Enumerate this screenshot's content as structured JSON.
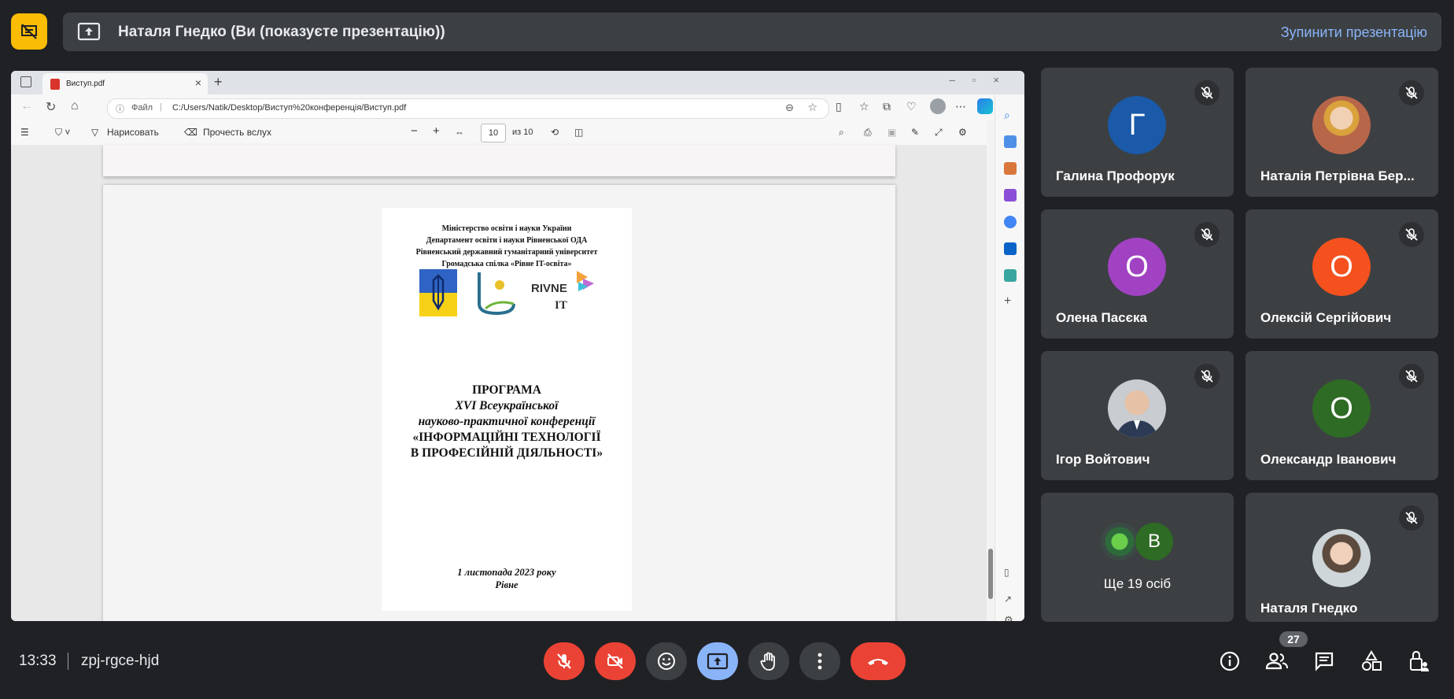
{
  "presentation_bar": {
    "presenter_text": "Наталя Гнедко (Ви (показуєте презентацію))",
    "stop_label": "Зупинити презентацію"
  },
  "browser": {
    "tab_title": "Виступ.pdf",
    "address_scheme": "Файл",
    "address_url": "C:/Users/Natik/Desktop/Виступ%20конференція/Виступ.pdf"
  },
  "pdf_toolbar": {
    "draw_label": "Нарисовать",
    "read_aloud_label": "Прочесть вслух",
    "page_current": "10",
    "page_total": "из 10"
  },
  "document": {
    "header_lines": [
      "Міністерство освіти і науки України",
      "Департамент освіти і науки Рівненської ОДА",
      "Рівненський державний гуманітарний університет",
      "Громадська спілка «Рівне IT-освіта»"
    ],
    "logo_text_1": "RIVNE",
    "logo_text_2": "IT",
    "title_lines": [
      "ПРОГРАМА",
      "XVI Всеукраїнської",
      "науково-практичної конференції",
      "«ІНФОРМАЦІЙНІ ТЕХНОЛОГІЇ",
      "В ПРОФЕСІЙНІЙ ДІЯЛЬНОСТІ»"
    ],
    "date_line": "1 листопада 2023 року",
    "place_line": "Рівне"
  },
  "participants": [
    {
      "name": "Галина Профорук",
      "initial": "Г",
      "color": "#1a5aa8"
    },
    {
      "name": "Наталія Петрівна Бер...",
      "initial": "",
      "color": "#b8664a"
    },
    {
      "name": "Олена Пасєка",
      "initial": "О",
      "color": "#a142c2"
    },
    {
      "name": "Олексій Сергійович",
      "initial": "О",
      "color": "#f4511e"
    },
    {
      "name": "Ігор Войтович",
      "initial": "",
      "color": "#c9ccd0"
    },
    {
      "name": "Олександр Іванович",
      "initial": "О",
      "color": "#2e6b24"
    },
    {
      "name": "Наталя Гнедко",
      "initial": "",
      "color": "#cfd6da"
    }
  ],
  "others_tile": {
    "label": "Ще 19 осіб",
    "initial": "В",
    "color": "#2e6b24"
  },
  "bottom_bar": {
    "time": "13:33",
    "meeting_code": "zpj-rgce-hjd",
    "people_count": "27"
  }
}
